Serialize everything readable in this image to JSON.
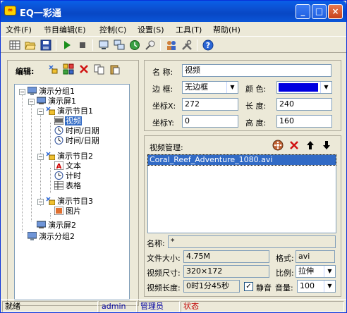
{
  "window": {
    "title": "EQ一彩通",
    "app_icon_text": "∞",
    "minimize": "_",
    "maximize": "□",
    "close": "×"
  },
  "menu": [
    "文件(F)",
    "节目编辑(E)",
    "控制(C)",
    "设置(S)",
    "工具(T)",
    "帮助(H)"
  ],
  "toolbar_icons": [
    "grid-icon",
    "open-folder-icon",
    "save-icon",
    "play-icon",
    "stop-icon",
    "send-icon",
    "send-all-icon",
    "clock-sync-icon",
    "link-icon",
    "users-icon",
    "tools-icon",
    "help-icon"
  ],
  "edit_panel": {
    "label": "编辑:"
  },
  "tree": {
    "items": [
      {
        "label": "演示分组1"
      },
      {
        "label": "演示屏1"
      },
      {
        "label": "演示节目1"
      },
      {
        "label": "视频"
      },
      {
        "label": "时间/日期"
      },
      {
        "label": "时间/日期"
      },
      {
        "label": "演示节目2"
      },
      {
        "label": "文本"
      },
      {
        "label": "计时"
      },
      {
        "label": "表格"
      },
      {
        "label": "演示节目3"
      },
      {
        "label": "图片"
      },
      {
        "label": "演示屏2"
      },
      {
        "label": "演示分组2"
      }
    ]
  },
  "props": {
    "name_label": "名 称:",
    "name_value": "视频",
    "border_label": "边 框:",
    "border_value": "无边框",
    "color_label": "颜 色:",
    "color_value": "#0000e0",
    "x_label": "坐标X:",
    "x_value": "272",
    "len_label": "长 度:",
    "len_value": "240",
    "y_label": "坐标Y:",
    "y_value": "0",
    "height_label": "高 度:",
    "height_value": "160"
  },
  "video": {
    "title": "视频管理:",
    "files": [
      "Coral_Reef_Adventure_1080.avi"
    ],
    "name_label": "名称:",
    "name_value": "*",
    "size_label": "文件大小:",
    "size_value": "4.75M",
    "format_label": "格式:",
    "format_value": "avi",
    "dim_label": "视频尺寸:",
    "dim_value": "320×172",
    "ratio_label": "比例:",
    "ratio_value": "拉伸",
    "duration_label": "视频长度:",
    "duration_value": "0时1分45秒",
    "mute_label": "静音",
    "mute_checked": "✓",
    "volume_label": "音量:",
    "volume_value": "100"
  },
  "status": {
    "ready": "就绪",
    "user": "admin",
    "role": "管理员",
    "state": "状态"
  }
}
